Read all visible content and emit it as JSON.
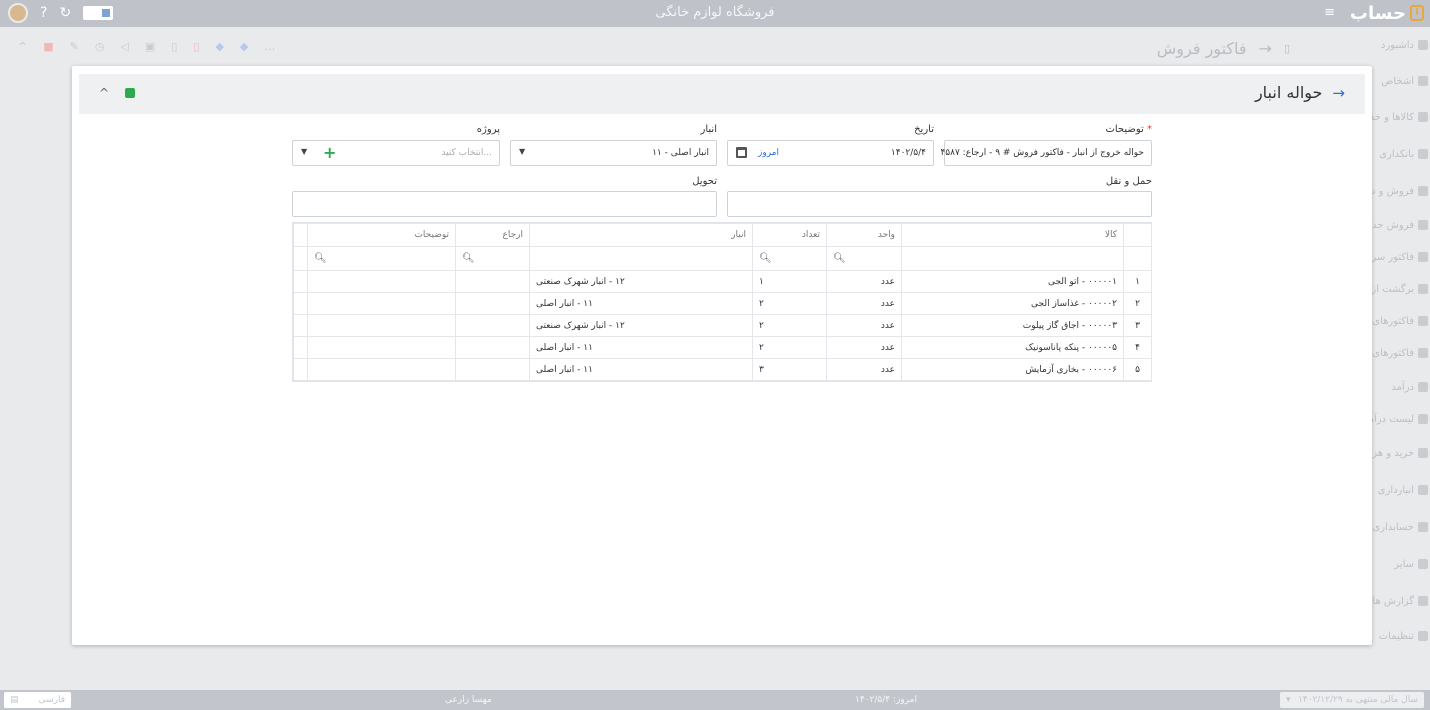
{
  "app": {
    "brand": "حساب",
    "store_title": "فروشگاه لوازم خانگی"
  },
  "page": {
    "title": "فاکتور فروش"
  },
  "sidebar": {
    "items": [
      "داشبورد",
      "اشخاص",
      "کالاها و خدمات",
      "بانکداری",
      "فروش و درآمد",
      "فروش جدید",
      "فاکتور سریع",
      "برگشت از فروش",
      "فاکتورهای فروش",
      "فاکتورهای برگشت",
      "درآمد",
      "لیست درآمد",
      "خرید و هزینه",
      "انبارداری",
      "حسابداری",
      "سایر",
      "گزارش ها",
      "تنظیمات"
    ]
  },
  "modal": {
    "title": "حواله انبار",
    "fields": {
      "description": {
        "label": "توضیحات",
        "required_mark": "*",
        "value": "حواله خروج از انبار - فاکتور فروش # ۹ - ارجاع: ۴۵۸۷"
      },
      "date": {
        "label": "تاریخ",
        "value": "۱۴۰۲/۵/۴",
        "today": "امروز"
      },
      "warehouse": {
        "label": "انبار",
        "value": "۱۱ - انبار اصلی"
      },
      "project": {
        "label": "پروژه",
        "placeholder": "انتخاب کنید..."
      },
      "shipping": {
        "label": "حمل و نقل",
        "value": ""
      },
      "delivery": {
        "label": "تحویل",
        "value": ""
      }
    },
    "grid": {
      "columns": {
        "kala": "کالا",
        "unit": "واحد",
        "qty": "تعداد",
        "anbar": "انبار",
        "ref": "ارجاع",
        "desc": "توضیحات"
      },
      "rows": [
        {
          "n": "۱",
          "kala": "۰۰۰۰۰۱ - اتو الجی",
          "unit": "عدد",
          "qty": "۱",
          "anbar": "۱۲ - انبار شهرک صنعتی",
          "ref": "",
          "desc": ""
        },
        {
          "n": "۲",
          "kala": "۰۰۰۰۰۲ - غذاساز الجی",
          "unit": "عدد",
          "qty": "۲",
          "anbar": "۱۱ - انبار اصلی",
          "ref": "",
          "desc": ""
        },
        {
          "n": "۳",
          "kala": "۰۰۰۰۰۳ - اجاق گاز پیلوت",
          "unit": "عدد",
          "qty": "۲",
          "anbar": "۱۲ - انبار شهرک صنعتی",
          "ref": "",
          "desc": ""
        },
        {
          "n": "۴",
          "kala": "۰۰۰۰۰۵ - پنکه پاناسونیک",
          "unit": "عدد",
          "qty": "۲",
          "anbar": "۱۱ - انبار اصلی",
          "ref": "",
          "desc": ""
        },
        {
          "n": "۵",
          "kala": "۰۰۰۰۰۶ - بخاری آزمایش",
          "unit": "عدد",
          "qty": "۳",
          "anbar": "۱۱ - انبار اصلی",
          "ref": "",
          "desc": ""
        }
      ]
    }
  },
  "footer": {
    "today": "امروز: ۱۴۰۲/۵/۴",
    "user": "مهسا زارعی",
    "language": "فارسی",
    "fiscal_year": "سال مالی منتهی به ۱۴۰۲/۱۲/۲۹"
  }
}
